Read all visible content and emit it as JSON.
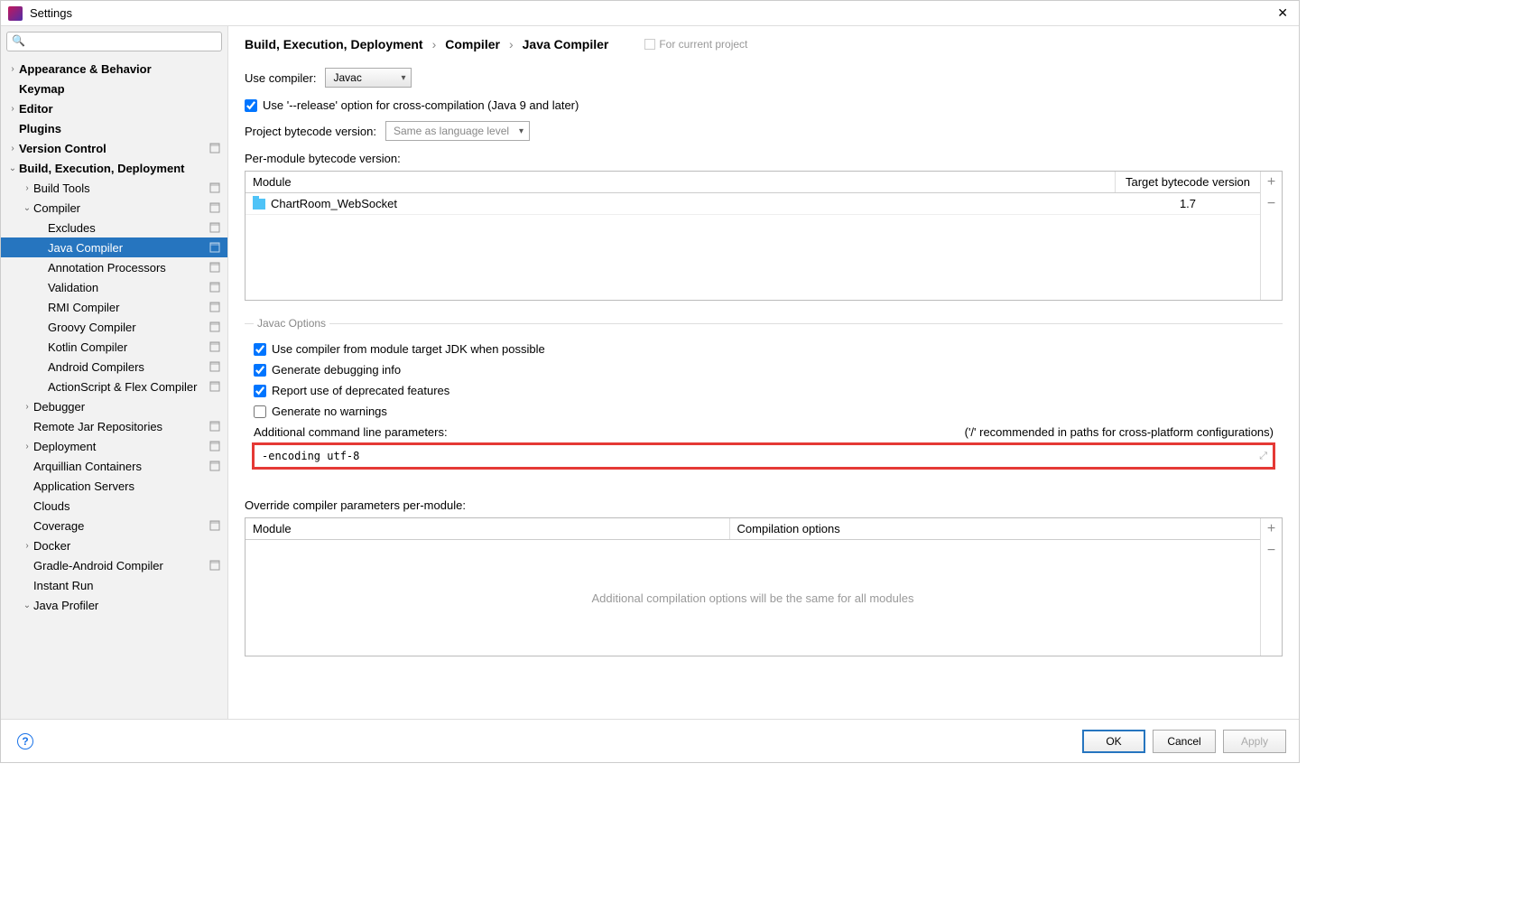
{
  "window": {
    "title": "Settings"
  },
  "search": {
    "placeholder": ""
  },
  "sidebar": {
    "items": [
      {
        "label": "Appearance & Behavior",
        "level": 0,
        "arrow": "right",
        "bold": true,
        "badge": false
      },
      {
        "label": "Keymap",
        "level": 0,
        "arrow": "none",
        "bold": true,
        "badge": false
      },
      {
        "label": "Editor",
        "level": 0,
        "arrow": "right",
        "bold": true,
        "badge": false
      },
      {
        "label": "Plugins",
        "level": 0,
        "arrow": "none",
        "bold": true,
        "badge": false
      },
      {
        "label": "Version Control",
        "level": 0,
        "arrow": "right",
        "bold": true,
        "badge": true
      },
      {
        "label": "Build, Execution, Deployment",
        "level": 0,
        "arrow": "down",
        "bold": true,
        "badge": false
      },
      {
        "label": "Build Tools",
        "level": 1,
        "arrow": "right",
        "bold": false,
        "badge": true
      },
      {
        "label": "Compiler",
        "level": 1,
        "arrow": "down",
        "bold": false,
        "badge": true
      },
      {
        "label": "Excludes",
        "level": 2,
        "arrow": "none",
        "bold": false,
        "badge": true
      },
      {
        "label": "Java Compiler",
        "level": 2,
        "arrow": "none",
        "bold": false,
        "badge": true,
        "selected": true
      },
      {
        "label": "Annotation Processors",
        "level": 2,
        "arrow": "none",
        "bold": false,
        "badge": true
      },
      {
        "label": "Validation",
        "level": 2,
        "arrow": "none",
        "bold": false,
        "badge": true
      },
      {
        "label": "RMI Compiler",
        "level": 2,
        "arrow": "none",
        "bold": false,
        "badge": true
      },
      {
        "label": "Groovy Compiler",
        "level": 2,
        "arrow": "none",
        "bold": false,
        "badge": true
      },
      {
        "label": "Kotlin Compiler",
        "level": 2,
        "arrow": "none",
        "bold": false,
        "badge": true
      },
      {
        "label": "Android Compilers",
        "level": 2,
        "arrow": "none",
        "bold": false,
        "badge": true
      },
      {
        "label": "ActionScript & Flex Compiler",
        "level": 2,
        "arrow": "none",
        "bold": false,
        "badge": true
      },
      {
        "label": "Debugger",
        "level": 1,
        "arrow": "right",
        "bold": false,
        "badge": false
      },
      {
        "label": "Remote Jar Repositories",
        "level": 1,
        "arrow": "none",
        "bold": false,
        "badge": true
      },
      {
        "label": "Deployment",
        "level": 1,
        "arrow": "right",
        "bold": false,
        "badge": true
      },
      {
        "label": "Arquillian Containers",
        "level": 1,
        "arrow": "none",
        "bold": false,
        "badge": true
      },
      {
        "label": "Application Servers",
        "level": 1,
        "arrow": "none",
        "bold": false,
        "badge": false
      },
      {
        "label": "Clouds",
        "level": 1,
        "arrow": "none",
        "bold": false,
        "badge": false
      },
      {
        "label": "Coverage",
        "level": 1,
        "arrow": "none",
        "bold": false,
        "badge": true
      },
      {
        "label": "Docker",
        "level": 1,
        "arrow": "right",
        "bold": false,
        "badge": false
      },
      {
        "label": "Gradle-Android Compiler",
        "level": 1,
        "arrow": "none",
        "bold": false,
        "badge": true
      },
      {
        "label": "Instant Run",
        "level": 1,
        "arrow": "none",
        "bold": false,
        "badge": false
      },
      {
        "label": "Java Profiler",
        "level": 1,
        "arrow": "down",
        "bold": false,
        "badge": false
      }
    ]
  },
  "breadcrumb": {
    "a": "Build, Execution, Deployment",
    "b": "Compiler",
    "c": "Java Compiler",
    "hint": "For current project"
  },
  "main": {
    "use_compiler_label": "Use compiler:",
    "use_compiler_value": "Javac",
    "release_option": "Use '--release' option for cross-compilation (Java 9 and later)",
    "project_bytecode_label": "Project bytecode version:",
    "project_bytecode_value": "Same as language level",
    "per_module_label": "Per-module bytecode version:",
    "table1": {
      "col1": "Module",
      "col2": "Target bytecode version",
      "rows": [
        {
          "module": "ChartRoom_WebSocket",
          "target": "1.7"
        }
      ]
    },
    "javac_legend": "Javac Options",
    "opt1": "Use compiler from module target JDK when possible",
    "opt2": "Generate debugging info",
    "opt3": "Report use of deprecated features",
    "opt4": "Generate no warnings",
    "params_label": "Additional command line parameters:",
    "params_hint": "('/' recommended in paths for cross-platform configurations)",
    "params_value": "-encoding utf-8",
    "override_label": "Override compiler parameters per-module:",
    "table2": {
      "col1": "Module",
      "col2": "Compilation options",
      "empty": "Additional compilation options will be the same for all modules"
    }
  },
  "footer": {
    "ok": "OK",
    "cancel": "Cancel",
    "apply": "Apply"
  }
}
